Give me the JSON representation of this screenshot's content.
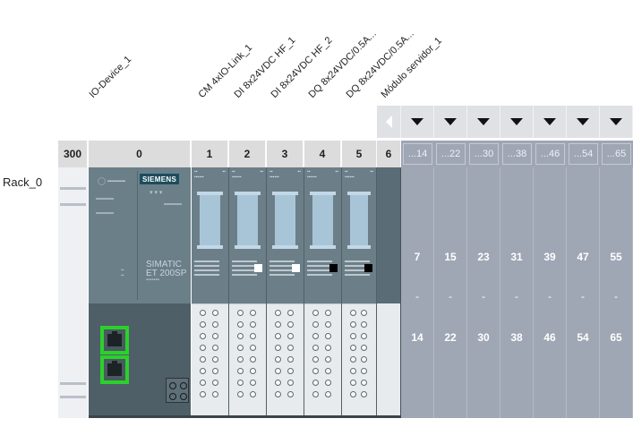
{
  "rack": {
    "name": "Rack_0"
  },
  "module_labels": [
    "IO-Device_1",
    "CM 4xIO-Link_1",
    "DI 8x24VDC HF_1",
    "DI 8x24VDC HF_2",
    "DQ 8x24VDC/0.5A...",
    "DQ 8x24VDC/0.5A...",
    "Módulo servidor_1"
  ],
  "slots": {
    "rail": "300",
    "interface": "0",
    "io": [
      "1",
      "2",
      "3",
      "4",
      "5"
    ],
    "server": "6"
  },
  "expansion": [
    {
      "header": "...14",
      "start": "7",
      "sep": "-",
      "end": "14"
    },
    {
      "header": "...22",
      "start": "15",
      "sep": "-",
      "end": "22"
    },
    {
      "header": "...30",
      "start": "23",
      "sep": "-",
      "end": "30"
    },
    {
      "header": "...38",
      "start": "31",
      "sep": "-",
      "end": "38"
    },
    {
      "header": "...46",
      "start": "39",
      "sep": "-",
      "end": "46"
    },
    {
      "header": "...54",
      "start": "47",
      "sep": "-",
      "end": "54"
    },
    {
      "header": "...65",
      "start": "55",
      "sep": "-",
      "end": "65"
    }
  ],
  "interface_module": {
    "brand": "SIEMENS",
    "product_line1": "SIMATIC",
    "product_line2": "ET 200SP"
  },
  "io_modules": [
    {
      "indicator": "none"
    },
    {
      "indicator": "white"
    },
    {
      "indicator": "white"
    },
    {
      "indicator": "black"
    },
    {
      "indicator": "black"
    }
  ],
  "colors": {
    "port_highlight": "#2bd12b",
    "expansion_bg": "#9fa6b4",
    "module_body": "#6c7f89"
  }
}
